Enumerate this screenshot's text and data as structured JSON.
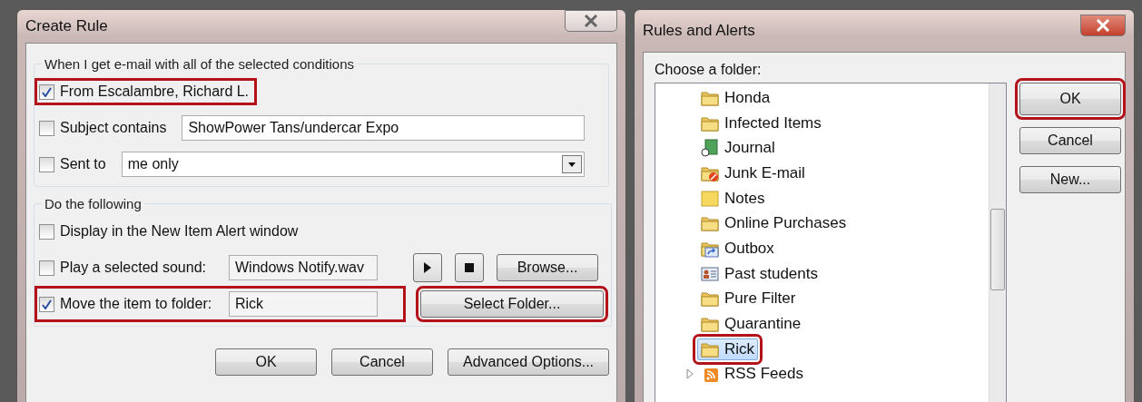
{
  "create_rule": {
    "title": "Create Rule",
    "conditions": {
      "legend": "When I get e-mail with all of the selected conditions",
      "rows": [
        {
          "kind": "plain",
          "label": "From Escalambre, Richard L.",
          "checked": true,
          "highlighted": true
        },
        {
          "kind": "text",
          "label": "Subject contains",
          "checked": false,
          "highlighted": false,
          "value": "ShowPower Tans/undercar Expo"
        },
        {
          "kind": "dropdown",
          "label": "Sent to",
          "checked": false,
          "highlighted": false,
          "value": "me only"
        }
      ]
    },
    "actions": {
      "legend": "Do the following",
      "rows": [
        {
          "kind": "plain",
          "label": "Display in the New Item Alert window",
          "checked": false,
          "highlighted": false
        },
        {
          "kind": "sound",
          "label": "Play a selected sound:",
          "checked": false,
          "highlighted": false,
          "value": "Windows Notify.wav",
          "button": {
            "label": "Browse...",
            "highlighted": false
          }
        },
        {
          "kind": "folder",
          "label": "Move the item to folder:",
          "checked": true,
          "highlighted": true,
          "value": "Rick",
          "button": {
            "label": "Select Folder...",
            "highlighted": true
          }
        }
      ]
    },
    "buttons": [
      "OK",
      "Cancel",
      "Advanced Options..."
    ]
  },
  "rules_and_alerts": {
    "title": "Rules and Alerts",
    "prompt": "Choose a folder:",
    "folders": [
      {
        "label": "Honda",
        "kind": "folder",
        "selected": false,
        "expandable": false
      },
      {
        "label": "Infected Items",
        "kind": "folder",
        "selected": false,
        "expandable": false
      },
      {
        "label": "Journal",
        "kind": "journal",
        "selected": false,
        "expandable": false
      },
      {
        "label": "Junk E-mail",
        "kind": "junk",
        "selected": false,
        "expandable": false
      },
      {
        "label": "Notes",
        "kind": "notes",
        "selected": false,
        "expandable": false
      },
      {
        "label": "Online Purchases",
        "kind": "folder",
        "selected": false,
        "expandable": false
      },
      {
        "label": "Outbox",
        "kind": "outbox",
        "selected": false,
        "expandable": false
      },
      {
        "label": "Past students",
        "kind": "contacts",
        "selected": false,
        "expandable": false
      },
      {
        "label": "Pure Filter",
        "kind": "folder",
        "selected": false,
        "expandable": false
      },
      {
        "label": "Quarantine",
        "kind": "folder",
        "selected": false,
        "expandable": false
      },
      {
        "label": "Rick",
        "kind": "folder",
        "selected": true,
        "expandable": false
      },
      {
        "label": "RSS Feeds",
        "kind": "rss",
        "selected": false,
        "expandable": true
      }
    ],
    "buttons": [
      {
        "label": "OK",
        "highlighted": true
      },
      {
        "label": "Cancel",
        "highlighted": false
      },
      {
        "label": "New...",
        "highlighted": false
      }
    ]
  }
}
